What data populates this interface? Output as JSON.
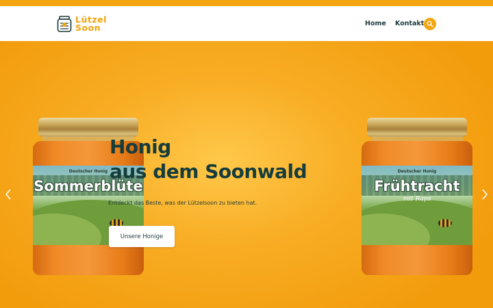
{
  "brand": {
    "name_line1": "Lützel",
    "name_line2": "Soon",
    "accent_color": "#f5a50f",
    "dark_color": "#163c3c",
    "logo_icon": "honey-jar-logo-icon"
  },
  "nav": {
    "items": [
      {
        "label": "Home"
      },
      {
        "label": "Kontakt"
      }
    ],
    "search_icon": "search-icon"
  },
  "hero": {
    "title_line1": "Honig",
    "title_line2": "aus dem Soonwald",
    "description": "Entdeckt das Beste, was der Lützelsoon zu bieten hat.",
    "cta_label": "Unsere Honige",
    "prev_icon": "chevron-left-icon",
    "next_icon": "chevron-right-icon",
    "products": [
      {
        "label_small": "Deutscher Honig",
        "label_big": "Sommerblüte",
        "label_sub": ""
      },
      {
        "label_small": "Deutscher Honig",
        "label_big": "Frühtracht",
        "label_sub": "mit Raps"
      }
    ]
  }
}
